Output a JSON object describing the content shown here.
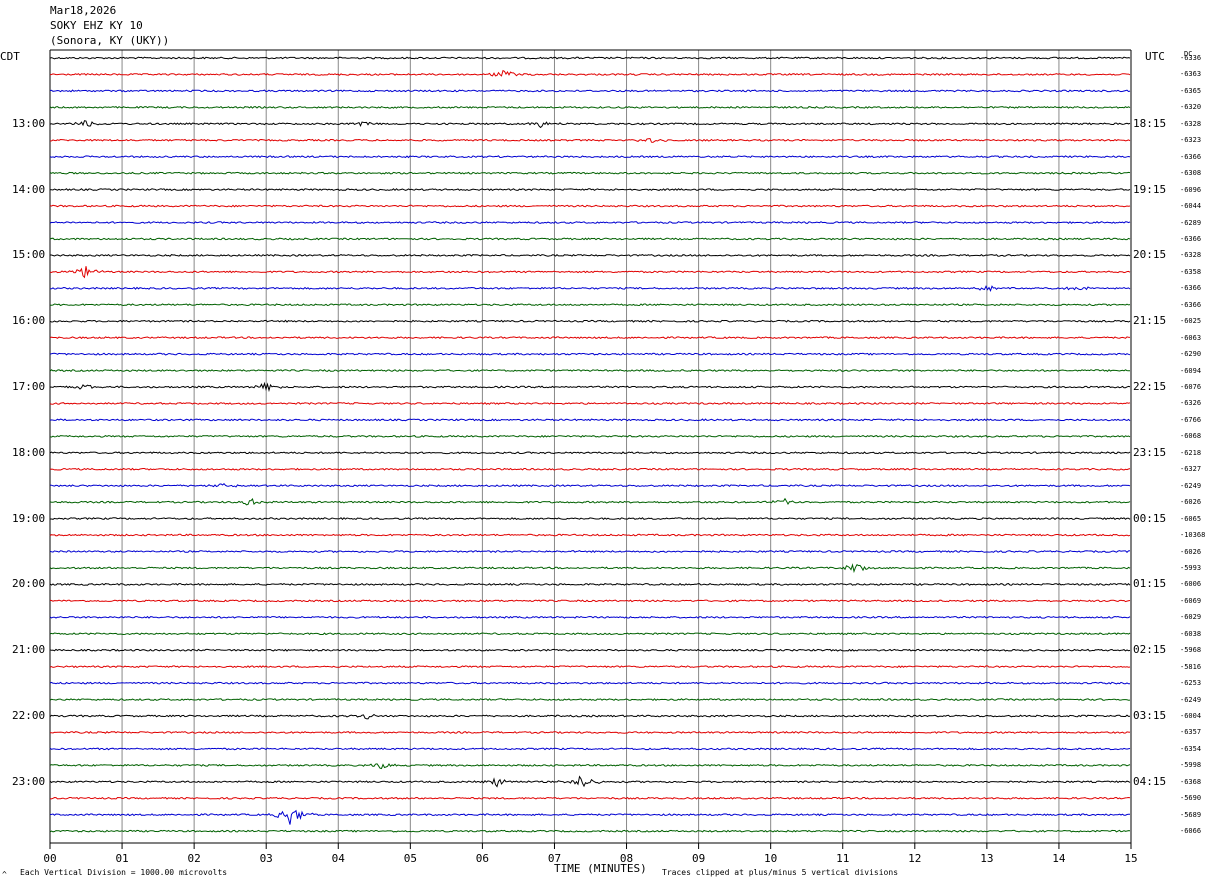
{
  "header": {
    "date": "Mar18,2026",
    "station": "SOKY EHZ KY 10",
    "location": "(Sonora, KY (UKY))"
  },
  "left_tz": "CDT",
  "right_tz": "UTC",
  "dc_header": "DC",
  "footer": {
    "scale_note": "Each Vertical Division = 1000.00 microvolts",
    "clip_note": "Traces clipped at plus/minus 5 vertical divisions",
    "corner_mark": "^"
  },
  "colors": [
    "#000000",
    "#e00000",
    "#0000d0",
    "#006000"
  ],
  "chart_data": {
    "type": "line",
    "xlabel": "TIME (MINUTES)",
    "x_ticks": [
      "00",
      "01",
      "02",
      "03",
      "04",
      "05",
      "06",
      "07",
      "08",
      "09",
      "10",
      "11",
      "12",
      "13",
      "14",
      "15"
    ],
    "xlim": [
      0,
      15
    ],
    "left_hour_labels": [
      "13:00",
      "14:00",
      "15:00",
      "16:00",
      "17:00",
      "18:00",
      "19:00",
      "20:00",
      "21:00",
      "22:00",
      "23:00"
    ],
    "right_hour_labels": [
      "18:15",
      "19:15",
      "20:15",
      "21:15",
      "22:15",
      "23:15",
      "00:15",
      "01:15",
      "02:15",
      "03:15",
      "04:15"
    ],
    "dc_offsets": [
      "-6336",
      "-6363",
      "-6365",
      "-6320",
      "-6328",
      "-6323",
      "-6366",
      "-6308",
      "-6096",
      "-6044",
      "-6289",
      "-6366",
      "-6328",
      "-6358",
      "-6366",
      "-6366",
      "-6025",
      "-6063",
      "-6290",
      "-6094",
      "-6076",
      "-6326",
      "-6766",
      "-6068",
      "-6218",
      "-6327",
      "-6249",
      "-6026",
      "-6065",
      "-10368",
      "-6026",
      "-5993",
      "-6006",
      "-6069",
      "-6029",
      "-6038",
      "-5968",
      "-5816",
      "-6253",
      "-6249",
      "-6004",
      "-6357",
      "-6354",
      "-5998",
      "-6368",
      "-5690",
      "-5689",
      "-6066"
    ],
    "events": [
      {
        "line": 1,
        "minute": 6.3,
        "amp": 5
      },
      {
        "line": 4,
        "minute": 0.5,
        "amp": 4
      },
      {
        "line": 4,
        "minute": 4.3,
        "amp": 3
      },
      {
        "line": 4,
        "minute": 6.8,
        "amp": 4
      },
      {
        "line": 5,
        "minute": 8.35,
        "amp": 3
      },
      {
        "line": 13,
        "minute": 0.5,
        "amp": 7
      },
      {
        "line": 14,
        "minute": 13.0,
        "amp": 3
      },
      {
        "line": 14,
        "minute": 14.3,
        "amp": 3
      },
      {
        "line": 20,
        "minute": 0.5,
        "amp": 3
      },
      {
        "line": 20,
        "minute": 3.0,
        "amp": 4
      },
      {
        "line": 26,
        "minute": 2.4,
        "amp": 3
      },
      {
        "line": 27,
        "minute": 2.8,
        "amp": 4
      },
      {
        "line": 27,
        "minute": 10.2,
        "amp": 4
      },
      {
        "line": 31,
        "minute": 11.2,
        "amp": 6
      },
      {
        "line": 40,
        "minute": 4.4,
        "amp": 3
      },
      {
        "line": 43,
        "minute": 4.6,
        "amp": 4
      },
      {
        "line": 44,
        "minute": 6.2,
        "amp": 5
      },
      {
        "line": 44,
        "minute": 7.4,
        "amp": 8
      },
      {
        "line": 46,
        "minute": 3.35,
        "amp": 12
      }
    ]
  }
}
